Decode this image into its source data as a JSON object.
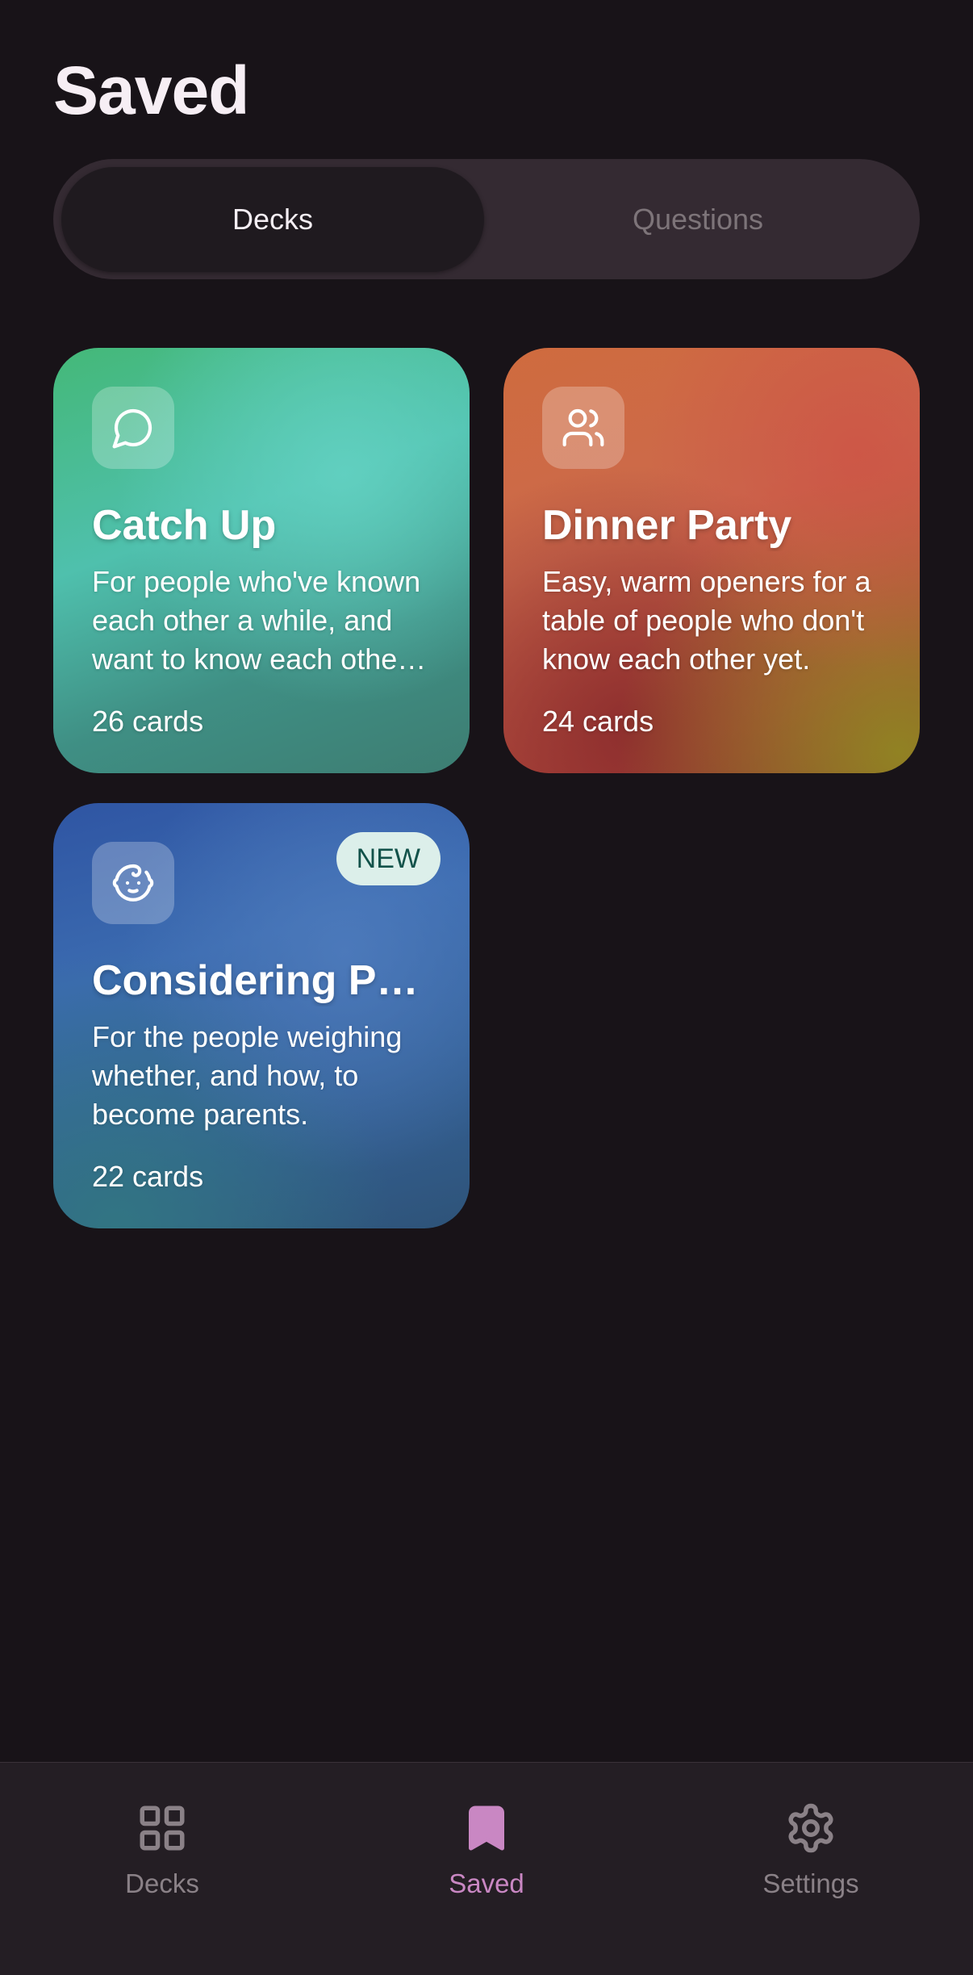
{
  "header": {
    "title": "Saved"
  },
  "segmented": {
    "tabs": [
      {
        "label": "Decks",
        "active": true
      },
      {
        "label": "Questions",
        "active": false
      }
    ]
  },
  "decks": [
    {
      "icon": "chat-bubble-icon",
      "title": "Catch Up",
      "description": "For people who've known each other a while, and want to know each other better.",
      "count": "26 cards",
      "color": "#4fc0ad"
    },
    {
      "icon": "people-icon",
      "title": "Dinner Party",
      "description": "Easy, warm openers for a table of people who don't know each other yet.",
      "count": "24 cards",
      "color": "#cc6a4c"
    },
    {
      "icon": "baby-icon",
      "title": "Considering Parenthood",
      "description": "For the people weighing whether, and how, to become parents.",
      "count": "22 cards",
      "badge": "NEW",
      "color": "#3b6bb0"
    }
  ],
  "bottom_nav": {
    "items": [
      {
        "label": "Decks",
        "icon": "grid-icon",
        "active": false
      },
      {
        "label": "Saved",
        "icon": "bookmark-icon",
        "active": true
      },
      {
        "label": "Settings",
        "icon": "gear-icon",
        "active": false
      }
    ]
  },
  "colors": {
    "background": "#181318",
    "accent": "#c987c3",
    "segmented_bg": "#342a32",
    "nav_bg": "#241e24"
  }
}
